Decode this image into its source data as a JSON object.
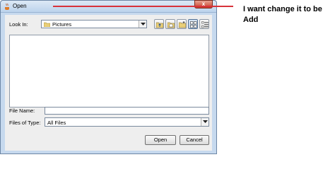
{
  "window": {
    "title": "Open",
    "close_glyph": "x"
  },
  "look_in": {
    "label": "Look In:",
    "value": "Pictures"
  },
  "toolbar": {
    "icons": [
      "up-folder-icon",
      "home-icon",
      "new-folder-icon",
      "list-view-icon",
      "details-view-icon"
    ]
  },
  "file_name": {
    "label": "File Name:",
    "value": ""
  },
  "files_of_type": {
    "label": "Files of Type:",
    "value": "All Files"
  },
  "buttons": {
    "open": "Open",
    "cancel": "Cancel"
  },
  "annotation": {
    "text": "I want change it to be Add",
    "color": "#d8333b"
  },
  "colors": {
    "frame": "#c6d9ee",
    "client": "#eeeeee"
  }
}
